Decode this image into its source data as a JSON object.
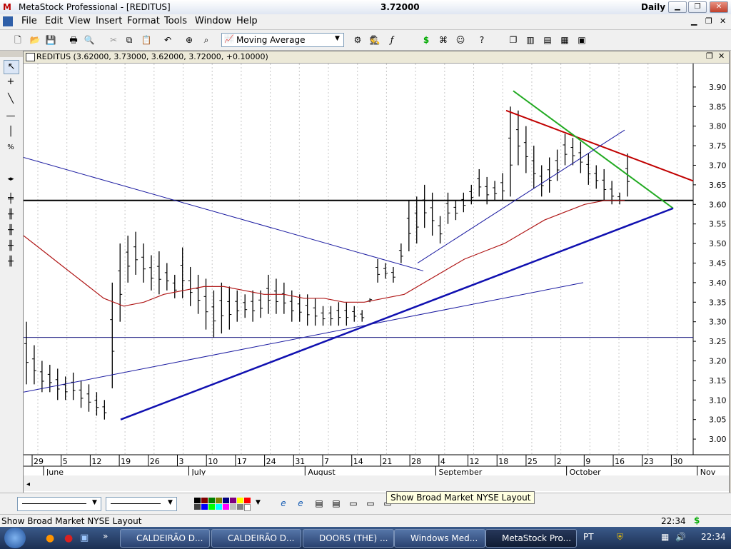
{
  "window": {
    "title": "MetaStock Professional - [REDITUS]",
    "last_price": "3.72000",
    "period": "Daily"
  },
  "menu": [
    "File",
    "Edit",
    "View",
    "Insert",
    "Format",
    "Tools",
    "Window",
    "Help"
  ],
  "toolbar": {
    "indicator_select": "Moving Average"
  },
  "chart_title": "REDITUS (3.62000, 3.73000, 3.62000, 3.72000, +0.10000)",
  "chart_data": {
    "type": "bar",
    "title": "REDITUS (3.62000, 3.73000, 3.62000, 3.72000, +0.10000)",
    "ylim": [
      2.96,
      3.96
    ],
    "y_ticks": [
      "3.90",
      "3.85",
      "3.80",
      "3.75",
      "3.70",
      "3.65",
      "3.60",
      "3.55",
      "3.50",
      "3.45",
      "3.40",
      "3.35",
      "3.30",
      "3.25",
      "3.20",
      "3.15",
      "3.10",
      "3.05",
      "3.00"
    ],
    "x_ticks": [
      "29",
      "5",
      "12",
      "19",
      "26",
      "3",
      "10",
      "17",
      "24",
      "31",
      "7",
      "14",
      "21",
      "28",
      "4",
      "12",
      "18",
      "25",
      "2",
      "9",
      "16",
      "23",
      "30"
    ],
    "months": [
      "June",
      "July",
      "August",
      "September",
      "October",
      "Nov"
    ],
    "grid": "vertical dotted",
    "ohlc_highs": [
      3.3,
      3.24,
      3.2,
      3.19,
      3.18,
      3.16,
      3.17,
      3.15,
      3.14,
      3.12,
      3.1,
      3.4,
      3.5,
      3.52,
      3.53,
      3.5,
      3.47,
      3.48,
      3.45,
      3.42,
      3.49,
      3.44,
      3.42,
      3.41,
      3.38,
      3.4,
      3.39,
      3.38,
      3.37,
      3.38,
      3.38,
      3.42,
      3.41,
      3.4,
      3.38,
      3.37,
      3.37,
      3.36,
      3.34,
      3.34,
      3.35,
      3.35,
      3.34,
      3.33,
      3.35,
      3.46,
      3.45,
      3.44,
      3.5,
      3.61,
      3.62,
      3.65,
      3.63,
      3.57,
      3.63,
      3.61,
      3.63,
      3.65,
      3.69,
      3.67,
      3.66,
      3.68,
      3.85,
      3.84,
      3.8,
      3.75,
      3.7,
      3.72,
      3.74,
      3.78,
      3.77,
      3.76,
      3.73,
      3.7,
      3.69,
      3.66,
      3.63,
      3.73
    ],
    "ohlc_lows": [
      3.14,
      3.14,
      3.12,
      3.12,
      3.1,
      3.1,
      3.1,
      3.08,
      3.07,
      3.06,
      3.05,
      3.13,
      3.3,
      3.4,
      3.42,
      3.4,
      3.38,
      3.37,
      3.38,
      3.36,
      3.36,
      3.34,
      3.32,
      3.28,
      3.26,
      3.27,
      3.28,
      3.3,
      3.31,
      3.3,
      3.31,
      3.32,
      3.32,
      3.32,
      3.3,
      3.3,
      3.29,
      3.29,
      3.29,
      3.29,
      3.29,
      3.29,
      3.3,
      3.3,
      3.36,
      3.4,
      3.41,
      3.4,
      3.45,
      3.48,
      3.5,
      3.54,
      3.52,
      3.5,
      3.55,
      3.56,
      3.58,
      3.6,
      3.62,
      3.6,
      3.61,
      3.61,
      3.62,
      3.7,
      3.68,
      3.64,
      3.62,
      3.63,
      3.66,
      3.7,
      3.7,
      3.68,
      3.65,
      3.64,
      3.61,
      3.6,
      3.6,
      3.62
    ],
    "moving_average": [
      3.52,
      3.48,
      3.44,
      3.4,
      3.36,
      3.34,
      3.35,
      3.37,
      3.38,
      3.39,
      3.39,
      3.38,
      3.37,
      3.37,
      3.36,
      3.36,
      3.35,
      3.35,
      3.36,
      3.37,
      3.4,
      3.43,
      3.46,
      3.48,
      3.5,
      3.53,
      3.56,
      3.58,
      3.6,
      3.61,
      3.61
    ],
    "horizontal_levels": [
      3.61,
      3.26
    ],
    "trendlines": [
      {
        "color": "#c00000",
        "from": [
          3.84
        ],
        "to": [
          3.66
        ]
      },
      {
        "color": "#22aa22",
        "from": [
          3.89
        ],
        "to": [
          3.59
        ]
      },
      {
        "color": "#1010b0",
        "from": [
          3.05
        ],
        "to": [
          3.59
        ]
      }
    ]
  },
  "tooltip": "Show Broad Market NYSE Layout",
  "status": {
    "text": "Show Broad Market NYSE Layout",
    "time": "22:34"
  },
  "taskbar": {
    "tasks": [
      "CALDEIRÃO D...",
      "CALDEIRÃO D...",
      "DOORS (THE) ...",
      "Windows Med...",
      "MetaStock Pro..."
    ],
    "lang": "PT",
    "clock": "22:34"
  }
}
